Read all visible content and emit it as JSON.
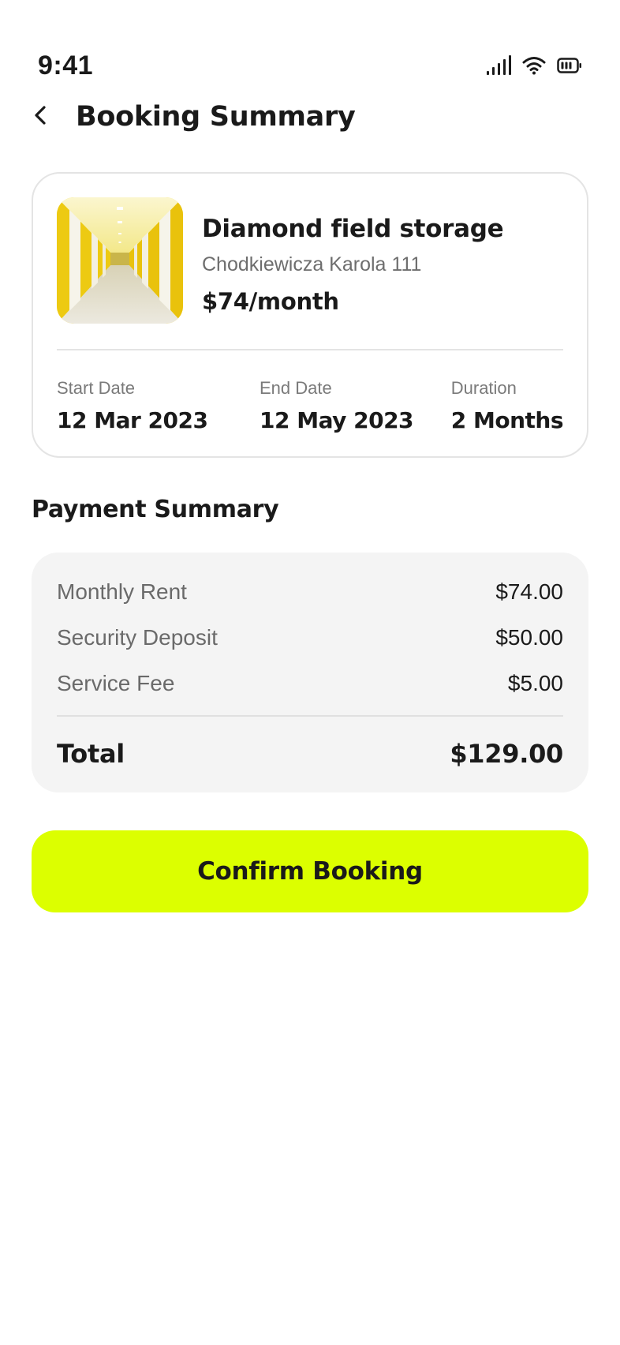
{
  "status_bar": {
    "time": "9:41",
    "icons": [
      "cellular-signal-icon",
      "wifi-icon",
      "battery-icon"
    ]
  },
  "header": {
    "back_icon": "chevron-left-icon",
    "title": "Booking Summary"
  },
  "storage": {
    "name": "Diamond field storage",
    "address": "Chodkiewicza Karola 111",
    "price": "$74/month",
    "accent_color": "#f2d21b"
  },
  "dates": [
    {
      "label": "Start Date",
      "value": "12 Mar 2023"
    },
    {
      "label": "End Date",
      "value": "12 May 2023"
    },
    {
      "label": "Duration",
      "value": "2 Months"
    }
  ],
  "payment": {
    "title": "Payment Summary",
    "items": [
      {
        "label": "Monthly Rent",
        "value": "$74.00"
      },
      {
        "label": "Security Deposit",
        "value": "$50.00"
      },
      {
        "label": "Service Fee",
        "value": "$5.00"
      }
    ],
    "total_label": "Total",
    "total_value": "$129.00"
  },
  "confirm": {
    "label": "Confirm Booking",
    "color": "#dcff00"
  }
}
